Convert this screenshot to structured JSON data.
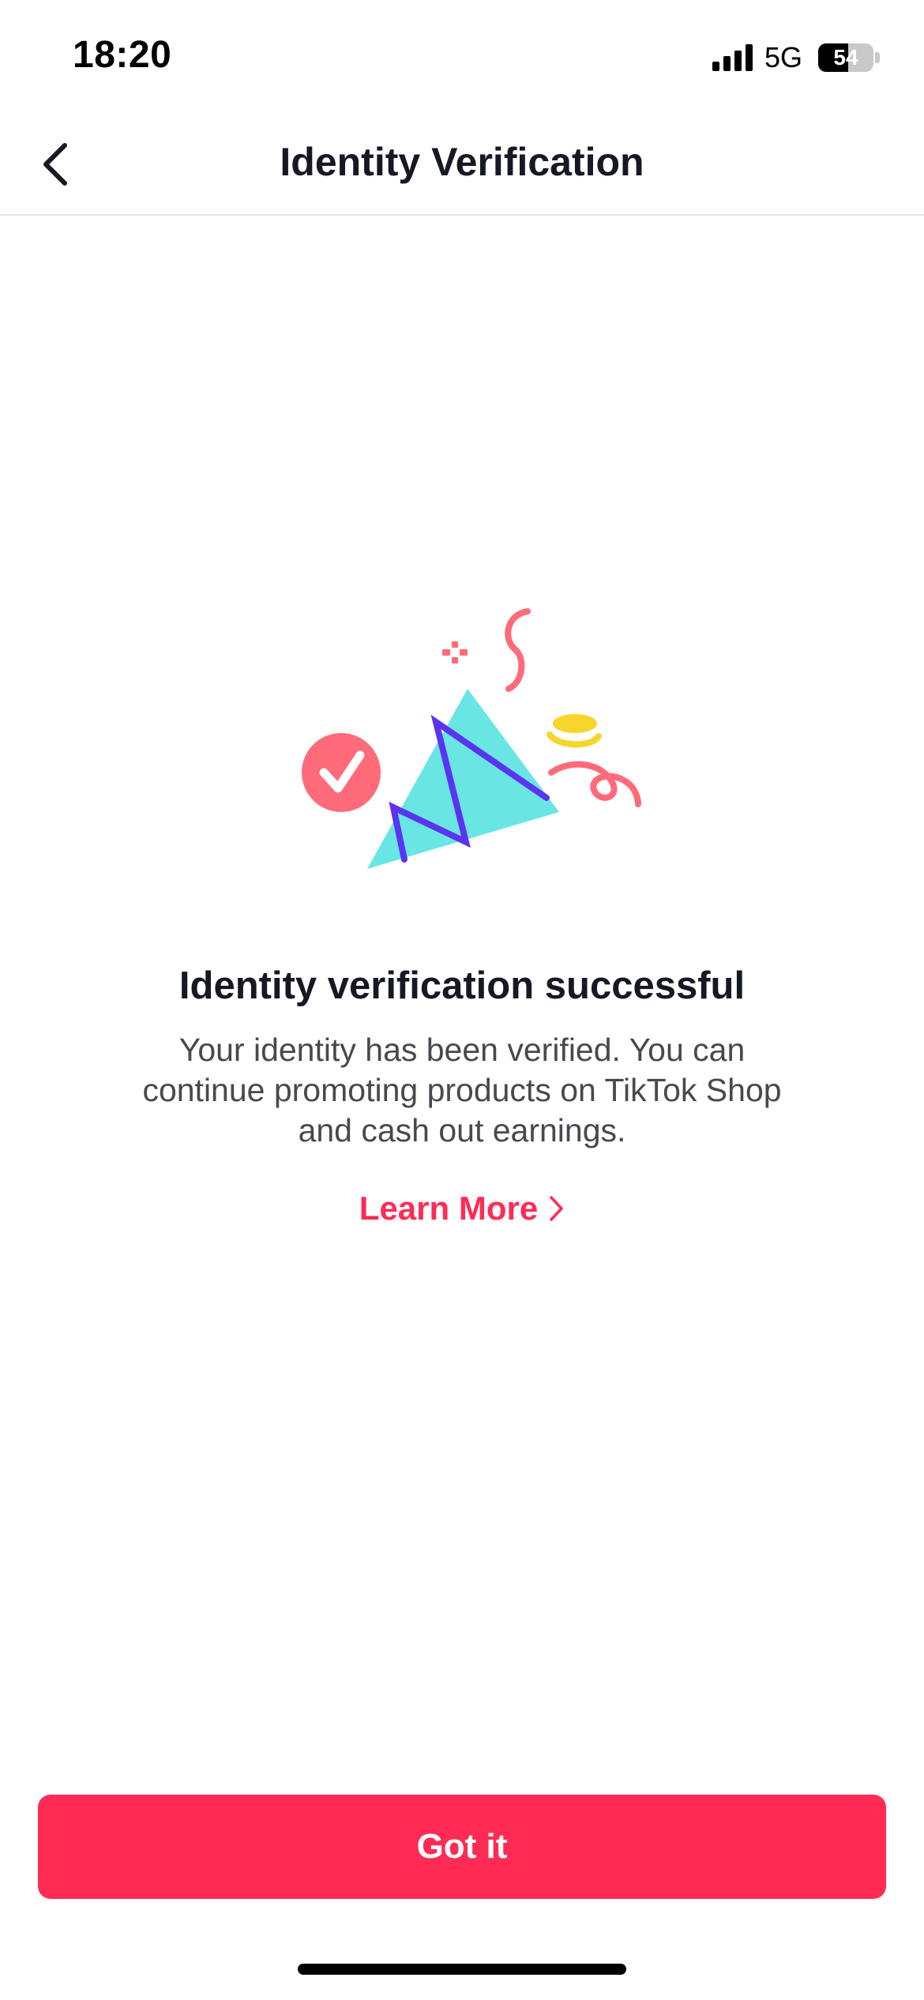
{
  "status_bar": {
    "time": "18:20",
    "network": "5G",
    "battery_level": "54",
    "battery_fraction": 0.54,
    "icons": [
      "signal-bars-icon",
      "battery-icon"
    ]
  },
  "nav": {
    "title": "Identity Verification",
    "back_icon": "chevron-left-icon"
  },
  "illustration": {
    "icon": "celebration-confetti-icon",
    "colors": {
      "checkmark_circle": "#ff6b78",
      "triangle": "#69e6e3",
      "zigzag": "#5a34f0",
      "confetti_pink": "#ff6b78",
      "confetti_yellow": "#f7d52c"
    }
  },
  "content": {
    "title": "Identity verification successful",
    "description": "Your identity has been verified. You can continue promoting products on TikTok Shop and cash out earnings.",
    "learn_more_label": "Learn More",
    "learn_more_icon": "chevron-right-icon"
  },
  "footer": {
    "button_label": "Got it"
  },
  "colors": {
    "accent": "#fe2c55",
    "title_text": "#161823",
    "body_text": "#48494f",
    "divider": "#e3e3e4"
  }
}
